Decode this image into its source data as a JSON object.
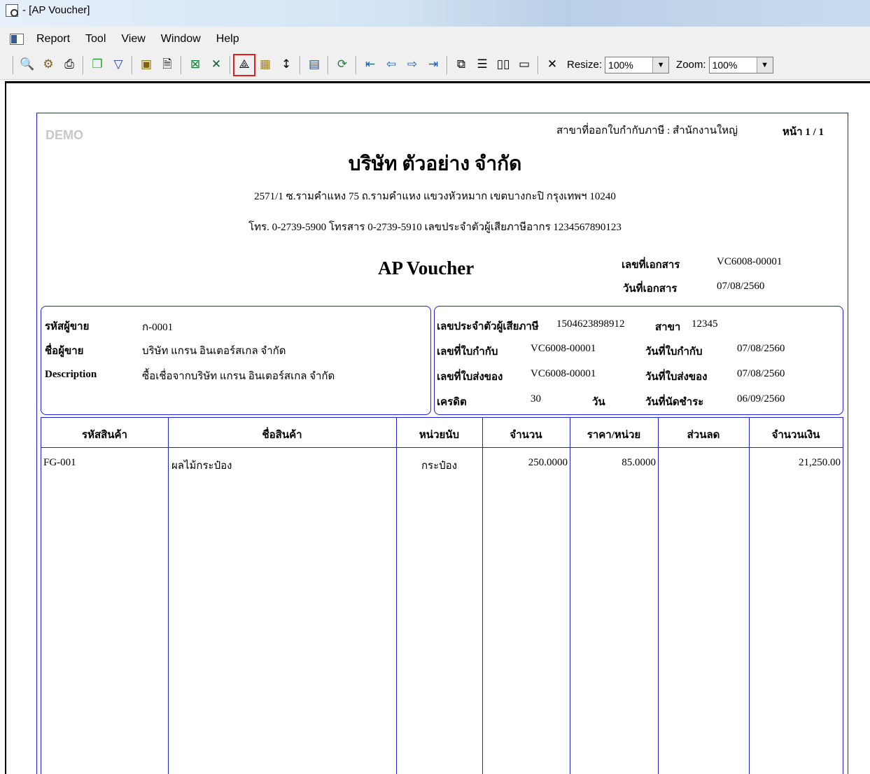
{
  "window": {
    "title": "- [AP Voucher]"
  },
  "menu": [
    "Report",
    "Tool",
    "View",
    "Window",
    "Help"
  ],
  "toolbar": {
    "icons": [
      "preview-icon",
      "print-setup-icon",
      "print-icon",
      "copy-icon",
      "filter-icon",
      "export-icon",
      "document-icon",
      "excel-icon",
      "excel-x-icon",
      "design-icon",
      "grid-icon",
      "fit-icon",
      "calculator-icon",
      "refresh-icon",
      "first-page-icon",
      "prev-page-icon",
      "next-page-icon",
      "last-page-icon",
      "tile-icon",
      "layout-rows-icon",
      "layout-columns-icon",
      "window-icon",
      "close-icon"
    ],
    "resize_label": "Resize:",
    "resize_value": "100%",
    "zoom_label": "Zoom:",
    "zoom_value": "100%"
  },
  "report": {
    "watermark": "DEMO",
    "branch": "สาขาที่ออกใบกำกับภาษี : สำนักงานใหญ่",
    "page_no": "หน้า 1 / 1",
    "company": "บริษัท ตัวอย่าง จำกัด",
    "address": "2571/1 ซ.รามคำแหง 75 ถ.รามคำแหง แขวงหัวหมาก เขตบางกะปิ กรุงเทพฯ 10240",
    "phone": "โทร. 0-2739-5900  โทรสาร 0-2739-5910  เลขประจำตัวผู้เสียภาษีอากร 1234567890123",
    "title": "AP Voucher",
    "doc_no_label": "เลขที่เอกสาร",
    "doc_no": "VC6008-00001",
    "doc_date_label": "วันที่เอกสาร",
    "doc_date": "07/08/2560",
    "vendor_code_label": "รหัสผู้ขาย",
    "vendor_code": "ก-0001",
    "vendor_name_label": "ชื่อผู้ขาย",
    "vendor_name": "บริษัท แกรน อินเตอร์สเกล จำกัด",
    "desc_label": "Description",
    "desc": "ซื้อเชื่อจากบริษัท แกรน อินเตอร์สเกล จำกัด",
    "tax_id_label": "เลขประจำตัวผู้เสียภาษี",
    "tax_id": "1504623898912",
    "branch_code_label": "สาขา",
    "branch_code": "12345",
    "invoice_no_label": "เลขที่ใบกำกับ",
    "invoice_no": "VC6008-00001",
    "invoice_date_label": "วันที่ใบกำกับ",
    "invoice_date": "07/08/2560",
    "delivery_no_label": "เลขที่ใบส่งของ",
    "delivery_no": "VC6008-00001",
    "delivery_date_label": "วันที่ใบส่งของ",
    "delivery_date": "07/08/2560",
    "credit_label": "เครดิต",
    "credit_days": "30",
    "days_unit": "วัน",
    "due_date_label": "วันที่นัดชำระ",
    "due_date": "06/09/2560",
    "columns": [
      "รหัสสินค้า",
      "ชื่อสินค้า",
      "หน่วยนับ",
      "จำนวน",
      "ราคา/หน่วย",
      "ส่วนลด",
      "จำนวนเงิน"
    ],
    "rows": [
      {
        "code": "FG-001",
        "name": "ผลไม้กระป๋อง",
        "unit": "กระป๋อง",
        "qty": "250.0000",
        "price": "85.0000",
        "discount": "",
        "amount": "21,250.00"
      }
    ]
  }
}
